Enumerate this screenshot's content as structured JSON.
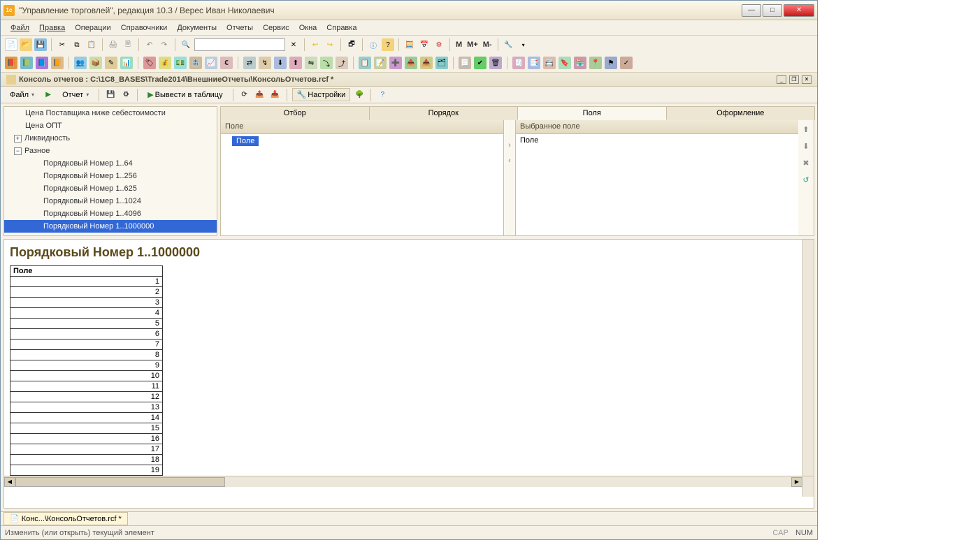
{
  "window_title": "\"Управление торговлей\", редакция 10.3 / Верес Иван Николаевич",
  "menu": [
    "Файл",
    "Правка",
    "Операции",
    "Справочники",
    "Документы",
    "Отчеты",
    "Сервис",
    "Окна",
    "Справка"
  ],
  "letters": {
    "m1": "M",
    "m2": "M+",
    "m3": "M-"
  },
  "subwindow_title": "Консоль отчетов : С:\\1С8_BASES\\Trade2014\\ВнешниеОтчеты\\КонсольОтчетов.rcf *",
  "sub_toolbar": {
    "file": "Файл",
    "report": "Отчет",
    "run": "Вывести в таблицу",
    "settings": "Настройки"
  },
  "tree": {
    "i0": "Цена Поставщика ниже себестоимости",
    "i1": "Цена ОПТ",
    "i2": "Ликвидность",
    "i3": "Разное",
    "c0": "Порядковый Номер 1..64",
    "c1": "Порядковый Номер 1..256",
    "c2": "Порядковый Номер 1..625",
    "c3": "Порядковый Номер 1..1024",
    "c4": "Порядковый Номер 1..4096",
    "c5": "Порядковый Номер 1..1000000"
  },
  "tabs": {
    "t0": "Отбор",
    "t1": "Порядок",
    "t2": "Поля",
    "t3": "Оформление"
  },
  "columns": {
    "left_header": "Поле",
    "right_header": "Выбранное поле",
    "left_val": "Поле",
    "right_val": "Поле"
  },
  "report": {
    "title": "Порядковый Номер 1..1000000",
    "header": "Поле",
    "rows": [
      "1",
      "2",
      "3",
      "4",
      "5",
      "6",
      "7",
      "8",
      "9",
      "10",
      "11",
      "12",
      "13",
      "14",
      "15",
      "16",
      "17",
      "18",
      "19"
    ]
  },
  "footer_tab": "Конс...\\КонсольОтчетов.rcf *",
  "status": {
    "text": "Изменить (или открыть) текущий элемент",
    "cap": "CAP",
    "num": "NUM"
  }
}
